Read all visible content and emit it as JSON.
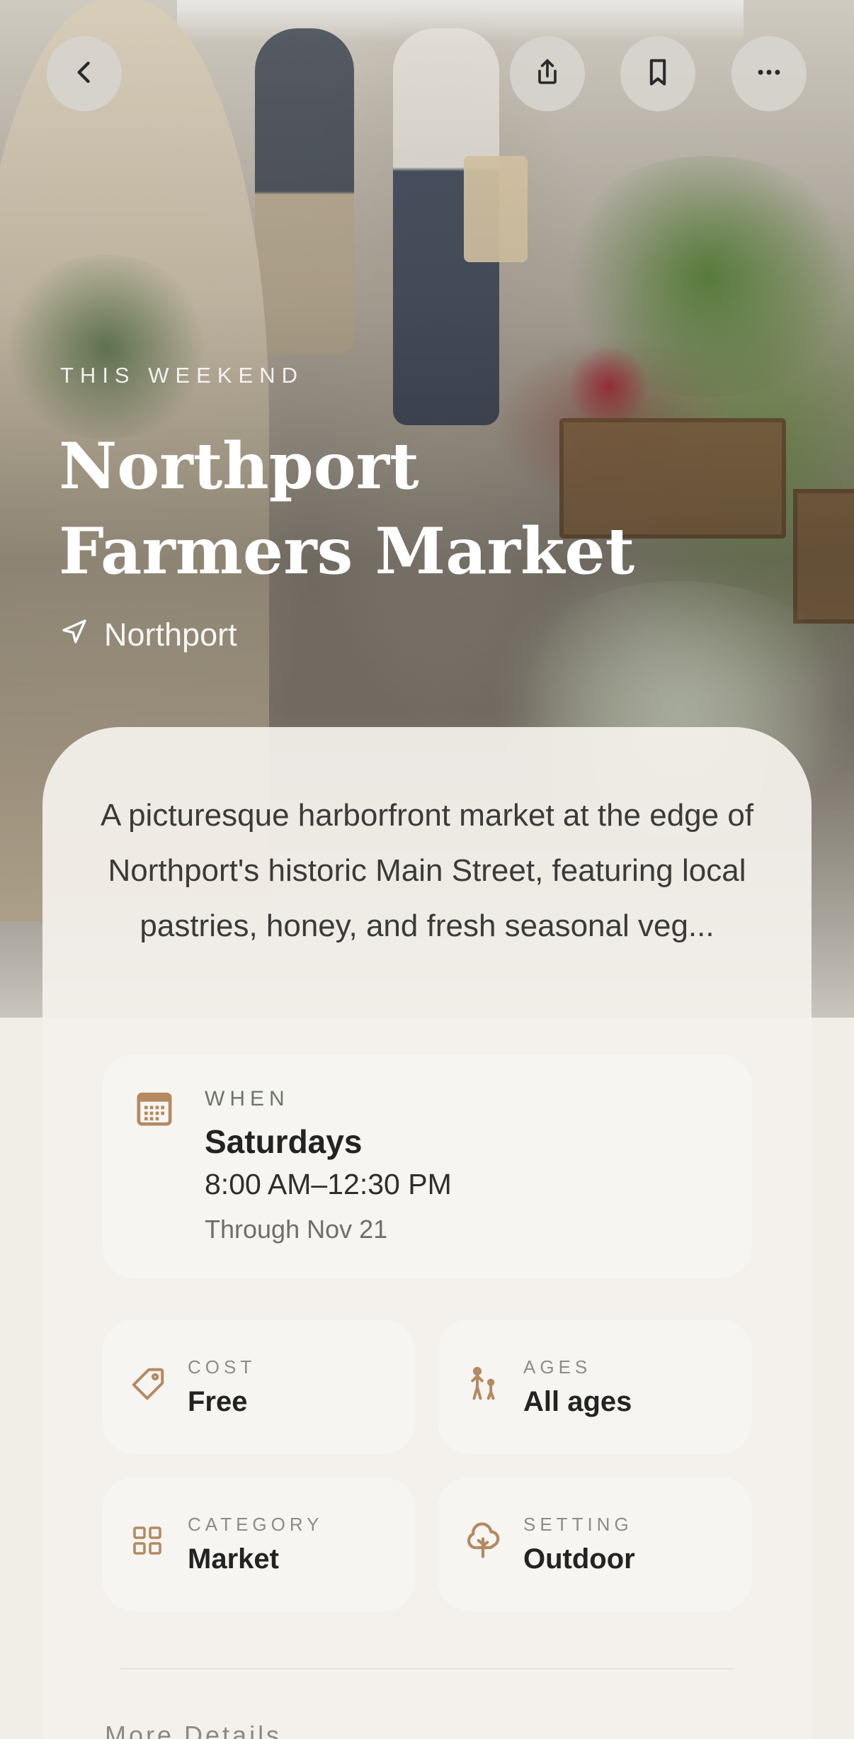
{
  "header": {
    "back_icon": "chevron-left-icon",
    "share_icon": "share-icon",
    "bookmark_icon": "bookmark-icon",
    "more_icon": "ellipsis-icon"
  },
  "hero": {
    "eyebrow": "THIS WEEKEND",
    "title_line1": "Northport",
    "title_line2": "Farmers Market",
    "location_icon": "navigation-arrow-icon",
    "location": "Northport"
  },
  "description": "A picturesque harborfront market at the edge of Northport's historic Main Street, featuring local pastries, honey, and fresh seasonal veg...",
  "when": {
    "icon": "calendar-icon",
    "label": "WHEN",
    "day": "Saturdays",
    "time": "8:00 AM–12:30 PM",
    "through": "Through Nov 21"
  },
  "details": {
    "cost": {
      "icon": "tag-icon",
      "label": "COST",
      "value": "Free"
    },
    "ages": {
      "icon": "family-icon",
      "label": "AGES",
      "value": "All ages"
    },
    "category": {
      "icon": "grid-icon",
      "label": "CATEGORY",
      "value": "Market"
    },
    "setting": {
      "icon": "tree-icon",
      "label": "SETTING",
      "value": "Outdoor"
    }
  },
  "more_details": "More Details",
  "colors": {
    "accent_icon": "#b38a62",
    "card_bg": "#f4f1ec",
    "tile_bg": "#f7f5f1",
    "title_text": "#ffffff",
    "body_text": "#3b3a38"
  }
}
